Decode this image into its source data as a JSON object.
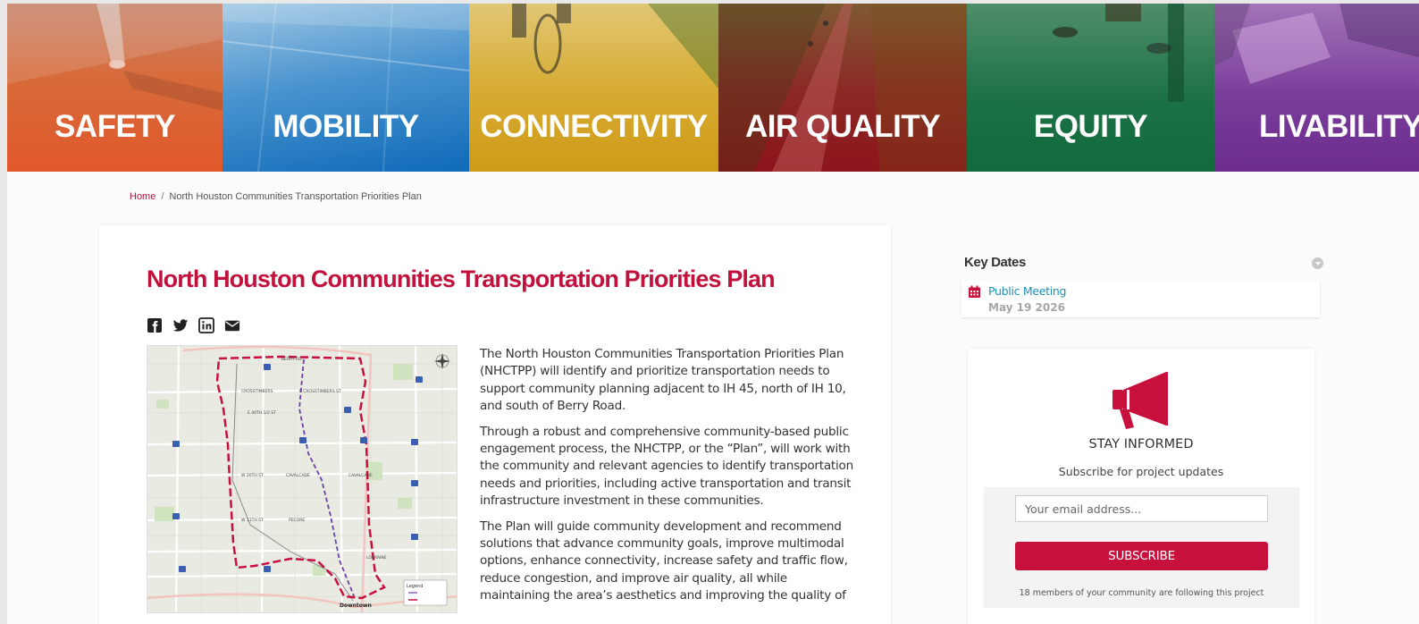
{
  "banner": {
    "panels": [
      {
        "label": "SAFETY"
      },
      {
        "label": "MOBILITY"
      },
      {
        "label": "CONNECTIVITY"
      },
      {
        "label": "AIR QUALITY"
      },
      {
        "label": "EQUITY"
      },
      {
        "label": "LIVABILITY"
      }
    ]
  },
  "breadcrumb": {
    "home": "Home",
    "separator": "/",
    "current": "North Houston Communities Transportation Priorities Plan"
  },
  "article": {
    "title": "North Houston Communities Transportation Priorities Plan",
    "share_icons": [
      "facebook-icon",
      "twitter-icon",
      "linkedin-icon",
      "email-icon"
    ],
    "map_labels": {
      "downtown": "Downtown",
      "legend": "Legend",
      "berry": "BERRY RD",
      "crosstimbers": "E CROSSTIMBERS ST",
      "crosstimbers2": "CROSSTIMBERS",
      "st40": "E 40TH 1/2 ST",
      "st20": "W 20TH ST",
      "st11": "W 11TH ST",
      "cavalcade": "CAVALCADE",
      "cavalcade2": "CAVALCADE",
      "pecore": "PECORE",
      "lorraine": "LORRAINE"
    },
    "paragraphs": [
      "The North Houston Communities Transportation Priorities Plan (NHCTPP) will identify and prioritize transportation needs to support community planning adjacent to IH 45, north of IH 10, and south of Berry Road.",
      "Through a robust and comprehensive community-based public engagement process, the NHCTPP, or the “Plan”, will work with the community and relevant agencies to identify transportation needs and priorities, including active transportation and transit infrastructure investment in these communities.",
      "The Plan will guide community development and recommend solutions that advance community goals, improve multimodal options, enhance connectivity, increase safety and traffic flow, reduce congestion, and improve air quality, all while maintaining the area’s aesthetics and improving the quality of"
    ]
  },
  "key_dates": {
    "title": "Key Dates",
    "items": [
      {
        "event": "Public Meeting",
        "date": "May 19 2026"
      }
    ]
  },
  "subscribe": {
    "icon": "megaphone-icon",
    "title": "STAY INFORMED",
    "subtitle": "Subscribe for project updates",
    "email_placeholder": "Your email address...",
    "button_label": "SUBSCRIBE",
    "members_text": "18 members of your community are following this project"
  },
  "colors": {
    "brand_red": "#c0123c",
    "link_blue": "#1b8fb5"
  }
}
